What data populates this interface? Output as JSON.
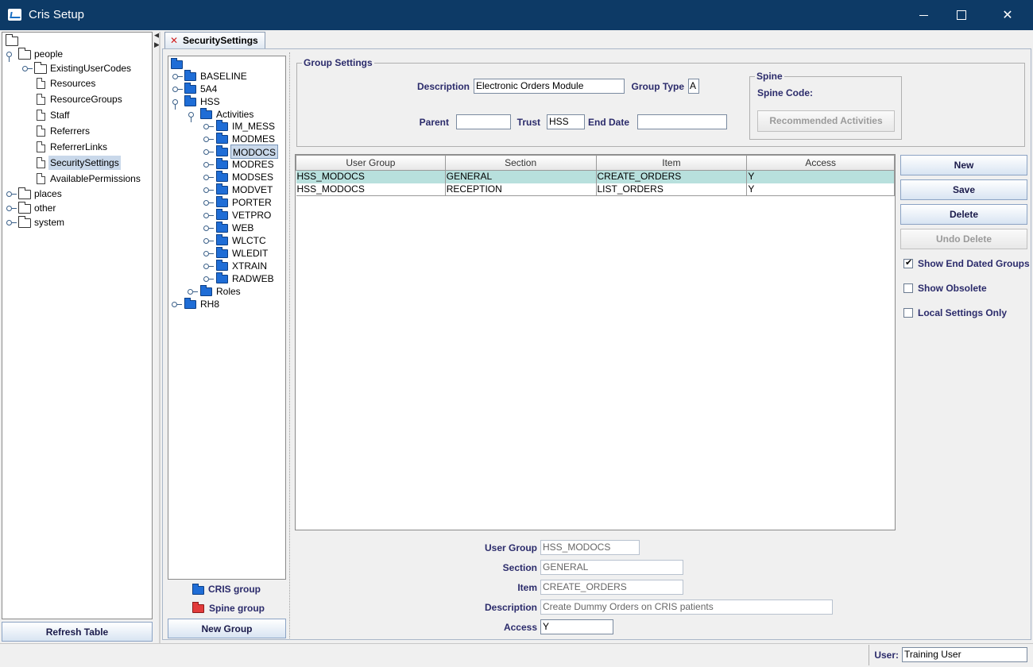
{
  "window": {
    "title": "Cris Setup"
  },
  "left_tree": {
    "people": "people",
    "people_children": [
      "ExistingUserCodes",
      "Resources",
      "ResourceGroups",
      "Staff",
      "Referrers",
      "ReferrerLinks",
      "SecuritySettings",
      "AvailablePermissions"
    ],
    "selected": "SecuritySettings",
    "others": [
      "places",
      "other",
      "system"
    ]
  },
  "refresh_button": "Refresh Table",
  "tab": {
    "label": "SecuritySettings"
  },
  "group_tree": {
    "top": [
      "BASELINE",
      "5A4",
      "HSS"
    ],
    "activities": "Activities",
    "activity_items": [
      "IM_MESS",
      "MODMES",
      "MODOCS",
      "MODRES",
      "MODSES",
      "MODVET",
      "PORTER",
      "VETPRO",
      "WEB",
      "WLCTC",
      "WLEDIT",
      "XTRAIN",
      "RADWEB"
    ],
    "selected": "MODOCS",
    "roles": "Roles",
    "last": "RH8"
  },
  "legend": {
    "cris_group": "CRIS group",
    "spine_group": "Spine group"
  },
  "new_group_button": "New Group",
  "group_settings": {
    "title": "Group Settings",
    "description_label": "Description",
    "description_value": "Electronic Orders Module",
    "group_type_label": "Group Type",
    "group_type_value": "A",
    "parent_label": "Parent",
    "parent_value": "",
    "trust_label": "Trust",
    "trust_value": "HSS",
    "end_date_label": "End Date",
    "end_date_value": "",
    "spine": {
      "title": "Spine",
      "code_label": "Spine Code:",
      "recommended_button": "Recommended Activities"
    }
  },
  "table": {
    "headers": [
      "User Group",
      "Section",
      "Item",
      "Access"
    ],
    "rows": [
      [
        "HSS_MODOCS",
        "GENERAL",
        "CREATE_ORDERS",
        "Y"
      ],
      [
        "HSS_MODOCS",
        "RECEPTION",
        "LIST_ORDERS",
        "Y"
      ]
    ]
  },
  "actions": {
    "new": "New",
    "save": "Save",
    "delete": "Delete",
    "undo_delete": "Undo Delete"
  },
  "options": {
    "show_end_dated": {
      "label": "Show End Dated Groups",
      "checked": true
    },
    "show_obsolete": {
      "label": "Show Obsolete",
      "checked": false
    },
    "local_only": {
      "label": "Local Settings Only",
      "checked": false
    }
  },
  "detail": {
    "user_group_label": "User Group",
    "user_group_value": "HSS_MODOCS",
    "section_label": "Section",
    "section_value": "GENERAL",
    "item_label": "Item",
    "item_value": "CREATE_ORDERS",
    "description_label": "Description",
    "description_value": "Create Dummy Orders on CRIS patients",
    "access_label": "Access",
    "access_value": "Y"
  },
  "status": {
    "user_label": "User:",
    "user_value": "Training User"
  }
}
